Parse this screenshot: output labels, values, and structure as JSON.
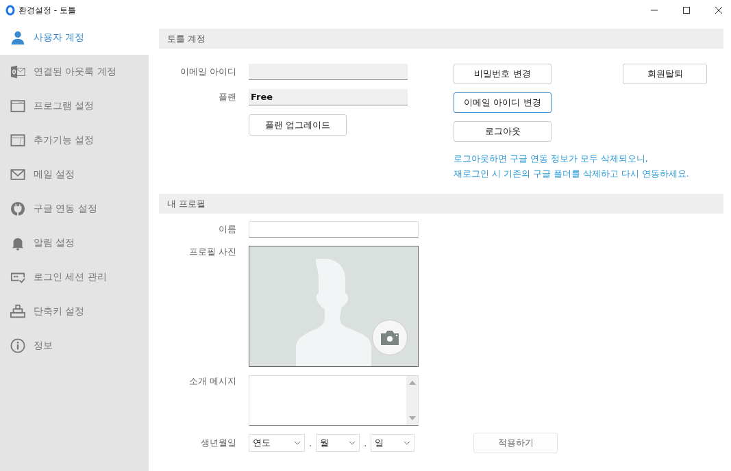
{
  "window": {
    "title": "환경설정 - 토틀"
  },
  "sidebar": {
    "items": [
      {
        "label": "사용자 계정",
        "kind": "user",
        "selected": true
      },
      {
        "label": "연결된 아웃룩 계정",
        "kind": "outlook",
        "selected": false
      },
      {
        "label": "프로그램 설정",
        "kind": "window",
        "selected": false
      },
      {
        "label": "추가기능 설정",
        "kind": "panel",
        "selected": false
      },
      {
        "label": "메일 설정",
        "kind": "mail",
        "selected": false
      },
      {
        "label": "구글 연동 설정",
        "kind": "plug",
        "selected": false
      },
      {
        "label": "알림 설정",
        "kind": "bell",
        "selected": false
      },
      {
        "label": "로그인 세션 관리",
        "kind": "session",
        "selected": false
      },
      {
        "label": "단축키 설정",
        "kind": "keys",
        "selected": false
      },
      {
        "label": "정보",
        "kind": "info",
        "selected": false
      }
    ]
  },
  "account": {
    "title": "토틀 계정",
    "email_label": "이메일 아이디",
    "plan_label": "플랜",
    "plan_value": "Free",
    "upgrade_button": "플랜 업그레이드",
    "buttons": [
      {
        "label": "비밀번호 변경",
        "focused": false
      },
      {
        "label": "이메일 아이디 변경",
        "focused": true
      },
      {
        "label": "로그아웃",
        "focused": false
      }
    ],
    "withdraw_button": "회원탈퇴",
    "notice": [
      "로그아웃하면 구글 연동 정보가 모두 삭제되오니,",
      "재로그인 시 기존의 구글 폴더를 삭제하고 다시 연동하세요."
    ]
  },
  "profile": {
    "title": "내 프로필",
    "name_label": "이름",
    "photo_label": "프로필 사진",
    "message_label": "소개 메시지",
    "birth_label": "생년월일",
    "birth_selects": [
      {
        "value": "연도"
      },
      {
        "value": "월"
      },
      {
        "value": "일"
      }
    ],
    "separator": ".",
    "apply_button": {
      "label": "적용하기",
      "disabled": true
    }
  }
}
